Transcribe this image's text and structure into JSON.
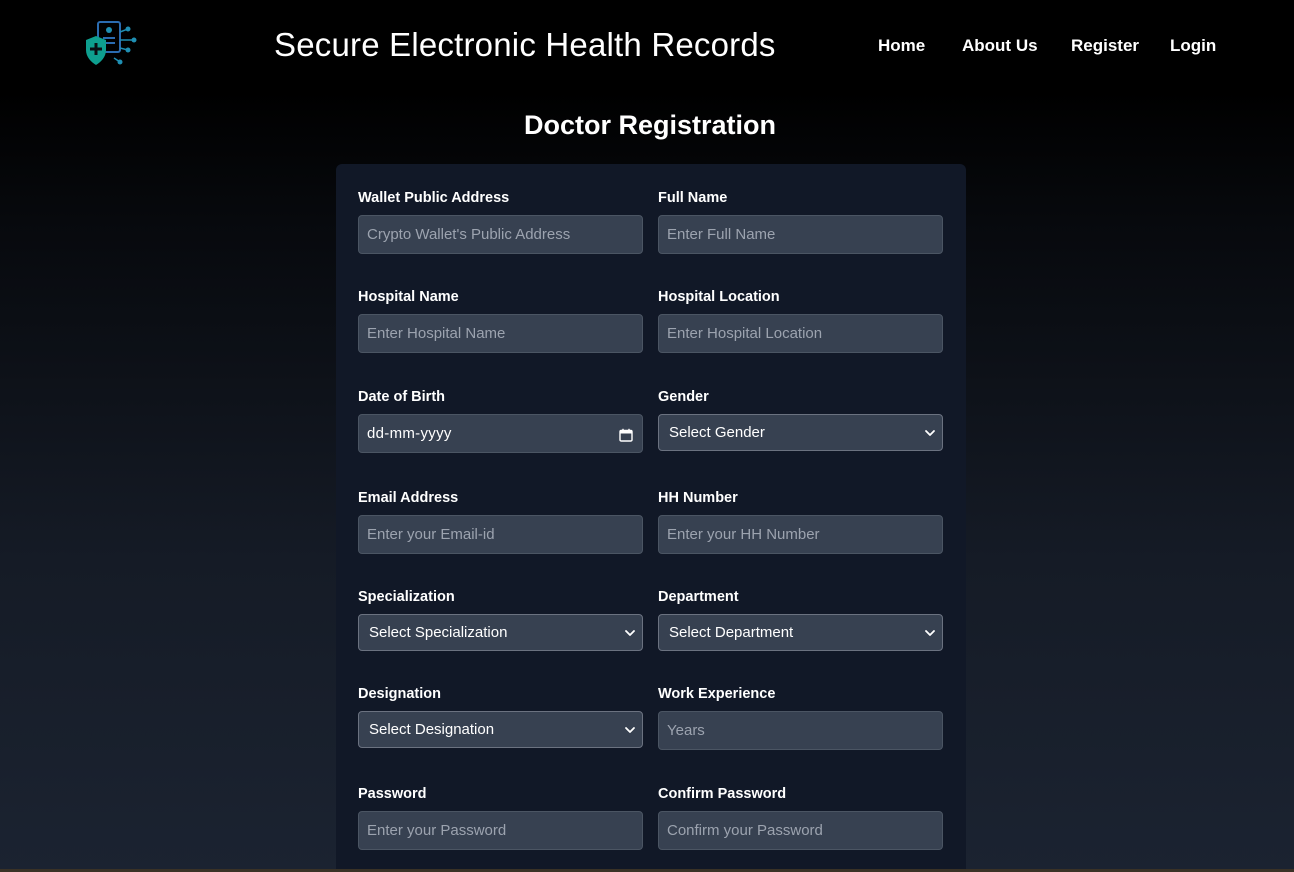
{
  "header": {
    "title": "Secure Electronic Health Records",
    "nav": {
      "home": "Home",
      "about": "About Us",
      "register": "Register",
      "login": "Login"
    }
  },
  "page": {
    "heading": "Doctor Registration"
  },
  "form": {
    "wallet": {
      "label": "Wallet Public Address",
      "placeholder": "Crypto Wallet's Public Address"
    },
    "full_name": {
      "label": "Full Name",
      "placeholder": "Enter Full Name"
    },
    "hospital_name": {
      "label": "Hospital Name",
      "placeholder": "Enter Hospital Name"
    },
    "hospital_location": {
      "label": "Hospital Location",
      "placeholder": "Enter Hospital Location"
    },
    "dob": {
      "label": "Date of Birth",
      "value": "dd-mm-yyyy"
    },
    "gender": {
      "label": "Gender",
      "value": "Select Gender"
    },
    "email": {
      "label": "Email Address",
      "placeholder": "Enter your Email-id"
    },
    "hh_number": {
      "label": "HH Number",
      "placeholder": "Enter your HH Number"
    },
    "specialization": {
      "label": "Specialization",
      "value": "Select Specialization"
    },
    "department": {
      "label": "Department",
      "value": "Select Department"
    },
    "designation": {
      "label": "Designation",
      "value": "Select Designation"
    },
    "work_experience": {
      "label": "Work Experience",
      "placeholder": "Years"
    },
    "password": {
      "label": "Password",
      "placeholder": "Enter your Password"
    },
    "confirm_password": {
      "label": "Confirm Password",
      "placeholder": "Confirm your Password"
    }
  },
  "icons": {
    "logo": "health-records-shield-logo",
    "select": "chevron-down-icon",
    "date": "calendar-icon"
  },
  "colors": {
    "background": "#000000",
    "card": "#111827",
    "input_bg": "#374151",
    "input_border": "#4b5563",
    "placeholder": "#9ca3af",
    "logo_teal": "#0e9f8f",
    "logo_blue": "#2b6cb0"
  }
}
